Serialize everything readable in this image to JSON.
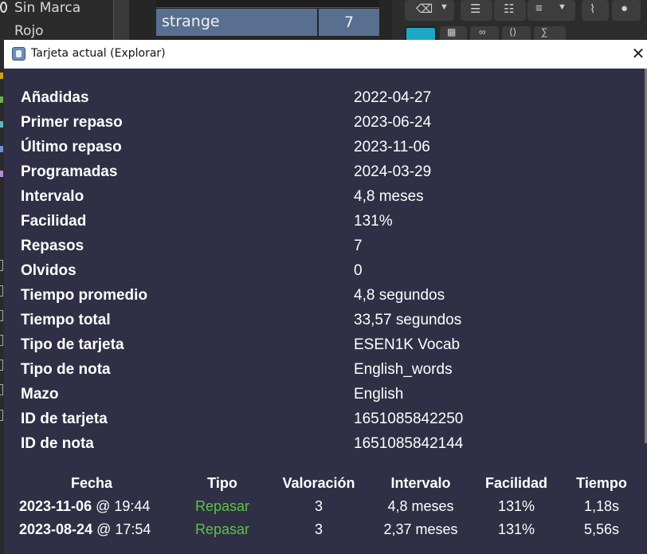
{
  "background": {
    "sidebar_items": [
      "Sin Marca",
      "Rojo"
    ],
    "table_row": {
      "term": "strange",
      "count": "7"
    }
  },
  "dialog": {
    "title": "Tarjeta actual (Explorar)",
    "close_label": "✕",
    "info": [
      {
        "key": "Añadidas",
        "value": "2022-04-27"
      },
      {
        "key": "Primer repaso",
        "value": "2023-06-24"
      },
      {
        "key": "Último repaso",
        "value": "2023-11-06"
      },
      {
        "key": "Programadas",
        "value": "2024-03-29"
      },
      {
        "key": "Intervalo",
        "value": "4,8 meses"
      },
      {
        "key": "Facilidad",
        "value": "131%"
      },
      {
        "key": "Repasos",
        "value": "7"
      },
      {
        "key": "Olvidos",
        "value": "0"
      },
      {
        "key": "Tiempo promedio",
        "value": "4,8 segundos"
      },
      {
        "key": "Tiempo total",
        "value": "33,57 segundos"
      },
      {
        "key": "Tipo de tarjeta",
        "value": "ESEN1K Vocab"
      },
      {
        "key": "Tipo de nota",
        "value": "English_words"
      },
      {
        "key": "Mazo",
        "value": "English"
      },
      {
        "key": "ID de tarjeta",
        "value": "1651085842250"
      },
      {
        "key": "ID de nota",
        "value": "1651085842144"
      }
    ],
    "reviews": {
      "headers": [
        "Fecha",
        "Tipo",
        "Valoración",
        "Intervalo",
        "Facilidad",
        "Tiempo"
      ],
      "rows": [
        {
          "date": "2023-11-06",
          "time": "@ 19:44",
          "type": "Repasar",
          "rating": "3",
          "interval": "4,8 meses",
          "ease": "131%",
          "duration": "1,18s"
        },
        {
          "date": "2023-08-24",
          "time": "@ 17:54",
          "type": "Repasar",
          "rating": "3",
          "interval": "2,37 meses",
          "ease": "131%",
          "duration": "5,56s"
        }
      ]
    }
  },
  "colors": {
    "dialog_bg": "#2f2f45",
    "review_type": "#5ec245",
    "selected_row": "#586f8f"
  }
}
